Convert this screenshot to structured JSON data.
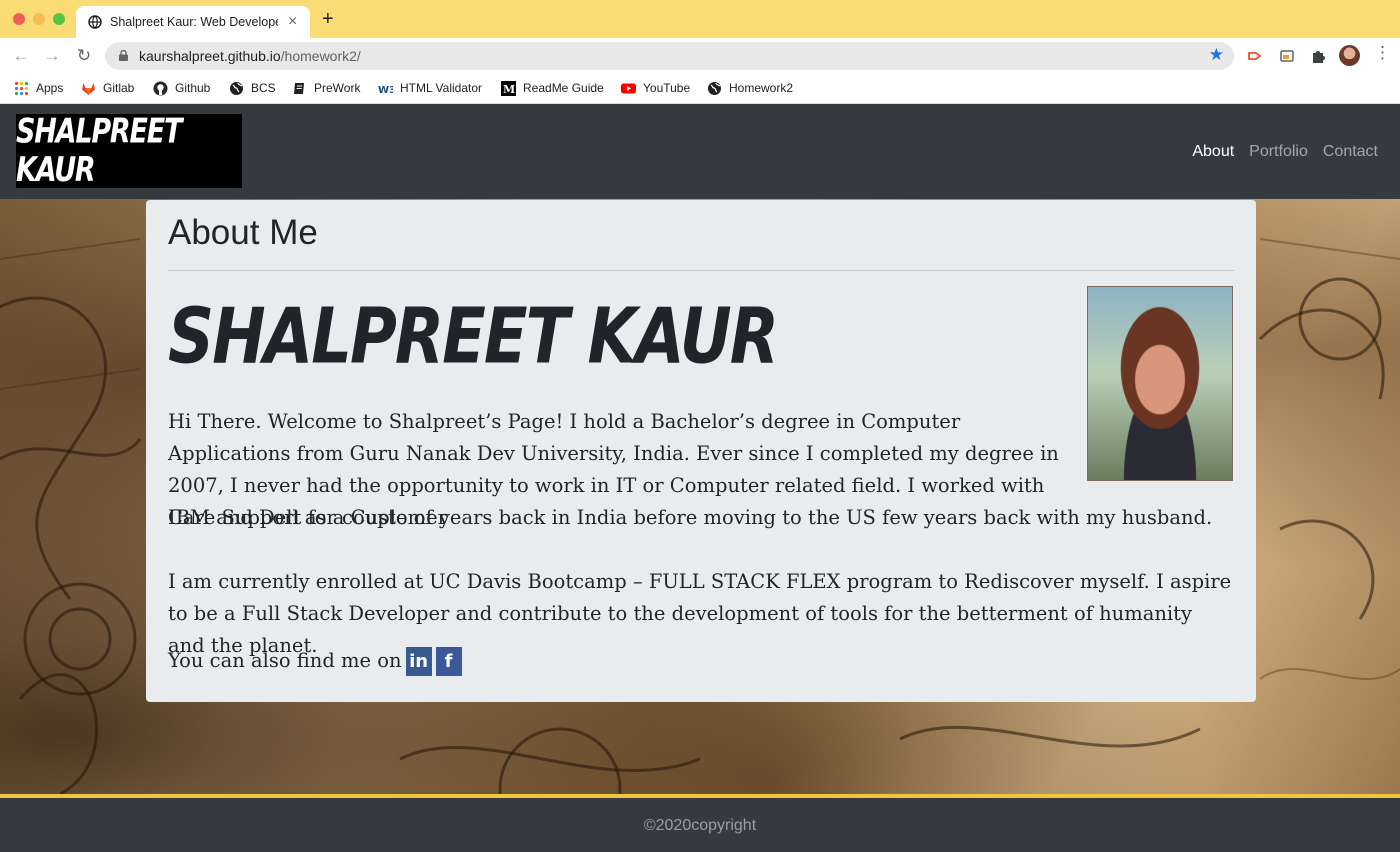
{
  "browser": {
    "tab_title": "Shalpreet Kaur: Web Developer",
    "tab_close": "×",
    "new_tab": "+",
    "url_host": "kaurshalpreet.github.io",
    "url_path": "/homework2/",
    "back": "←",
    "forward": "→",
    "reload": "↻",
    "star": "★",
    "menu": "⋮",
    "bookmarks": [
      {
        "label": "Apps",
        "icon": "apps-grid-icon"
      },
      {
        "label": "Gitlab",
        "icon": "gitlab-icon"
      },
      {
        "label": "Github",
        "icon": "github-icon"
      },
      {
        "label": "BCS",
        "icon": "globe-icon"
      },
      {
        "label": "PreWork",
        "icon": "book-icon"
      },
      {
        "label": "HTML Validator",
        "icon": "w3c-icon"
      },
      {
        "label": "ReadMe Guide",
        "icon": "medium-icon"
      },
      {
        "label": "YouTube",
        "icon": "youtube-icon"
      },
      {
        "label": "Homework2",
        "icon": "globe-icon"
      }
    ]
  },
  "site": {
    "logo_text": "SHALPREET KAUR",
    "nav": [
      "About",
      "Portfolio",
      "Contact"
    ],
    "active_nav": "About"
  },
  "about": {
    "title": "About Me",
    "name": "SHALPREET KAUR",
    "bio_1": "Hi There. Welcome to Shalpreet’s Page! I hold a Bachelor’s degree in Computer Applications from Guru Nanak Dev University, India. Ever since I completed my degree in 2007, I never had the opportunity to work in IT or Computer related field. I worked with IBM and Dell as a Customer",
    "bio_1b": "Care Support for couple of years back in India before moving to the US few years back with my husband.",
    "bio_2": "I am currently enrolled at UC Davis Bootcamp – FULL STACK FLEX program to Rediscover myself. I aspire to be a Full Stack Developer and contribute to the development of tools for the betterment of humanity and the planet.",
    "find_me": "You can also find me on",
    "social": [
      "in",
      "f"
    ]
  },
  "footer": {
    "text": "©2020copyright"
  },
  "colors": {
    "tabbar": "#f9dc74",
    "navbar": "#343a40",
    "card": "#e9ecef",
    "gold_line": "#f0c43c",
    "linkedin": "#365a91",
    "facebook": "#3b5998"
  }
}
